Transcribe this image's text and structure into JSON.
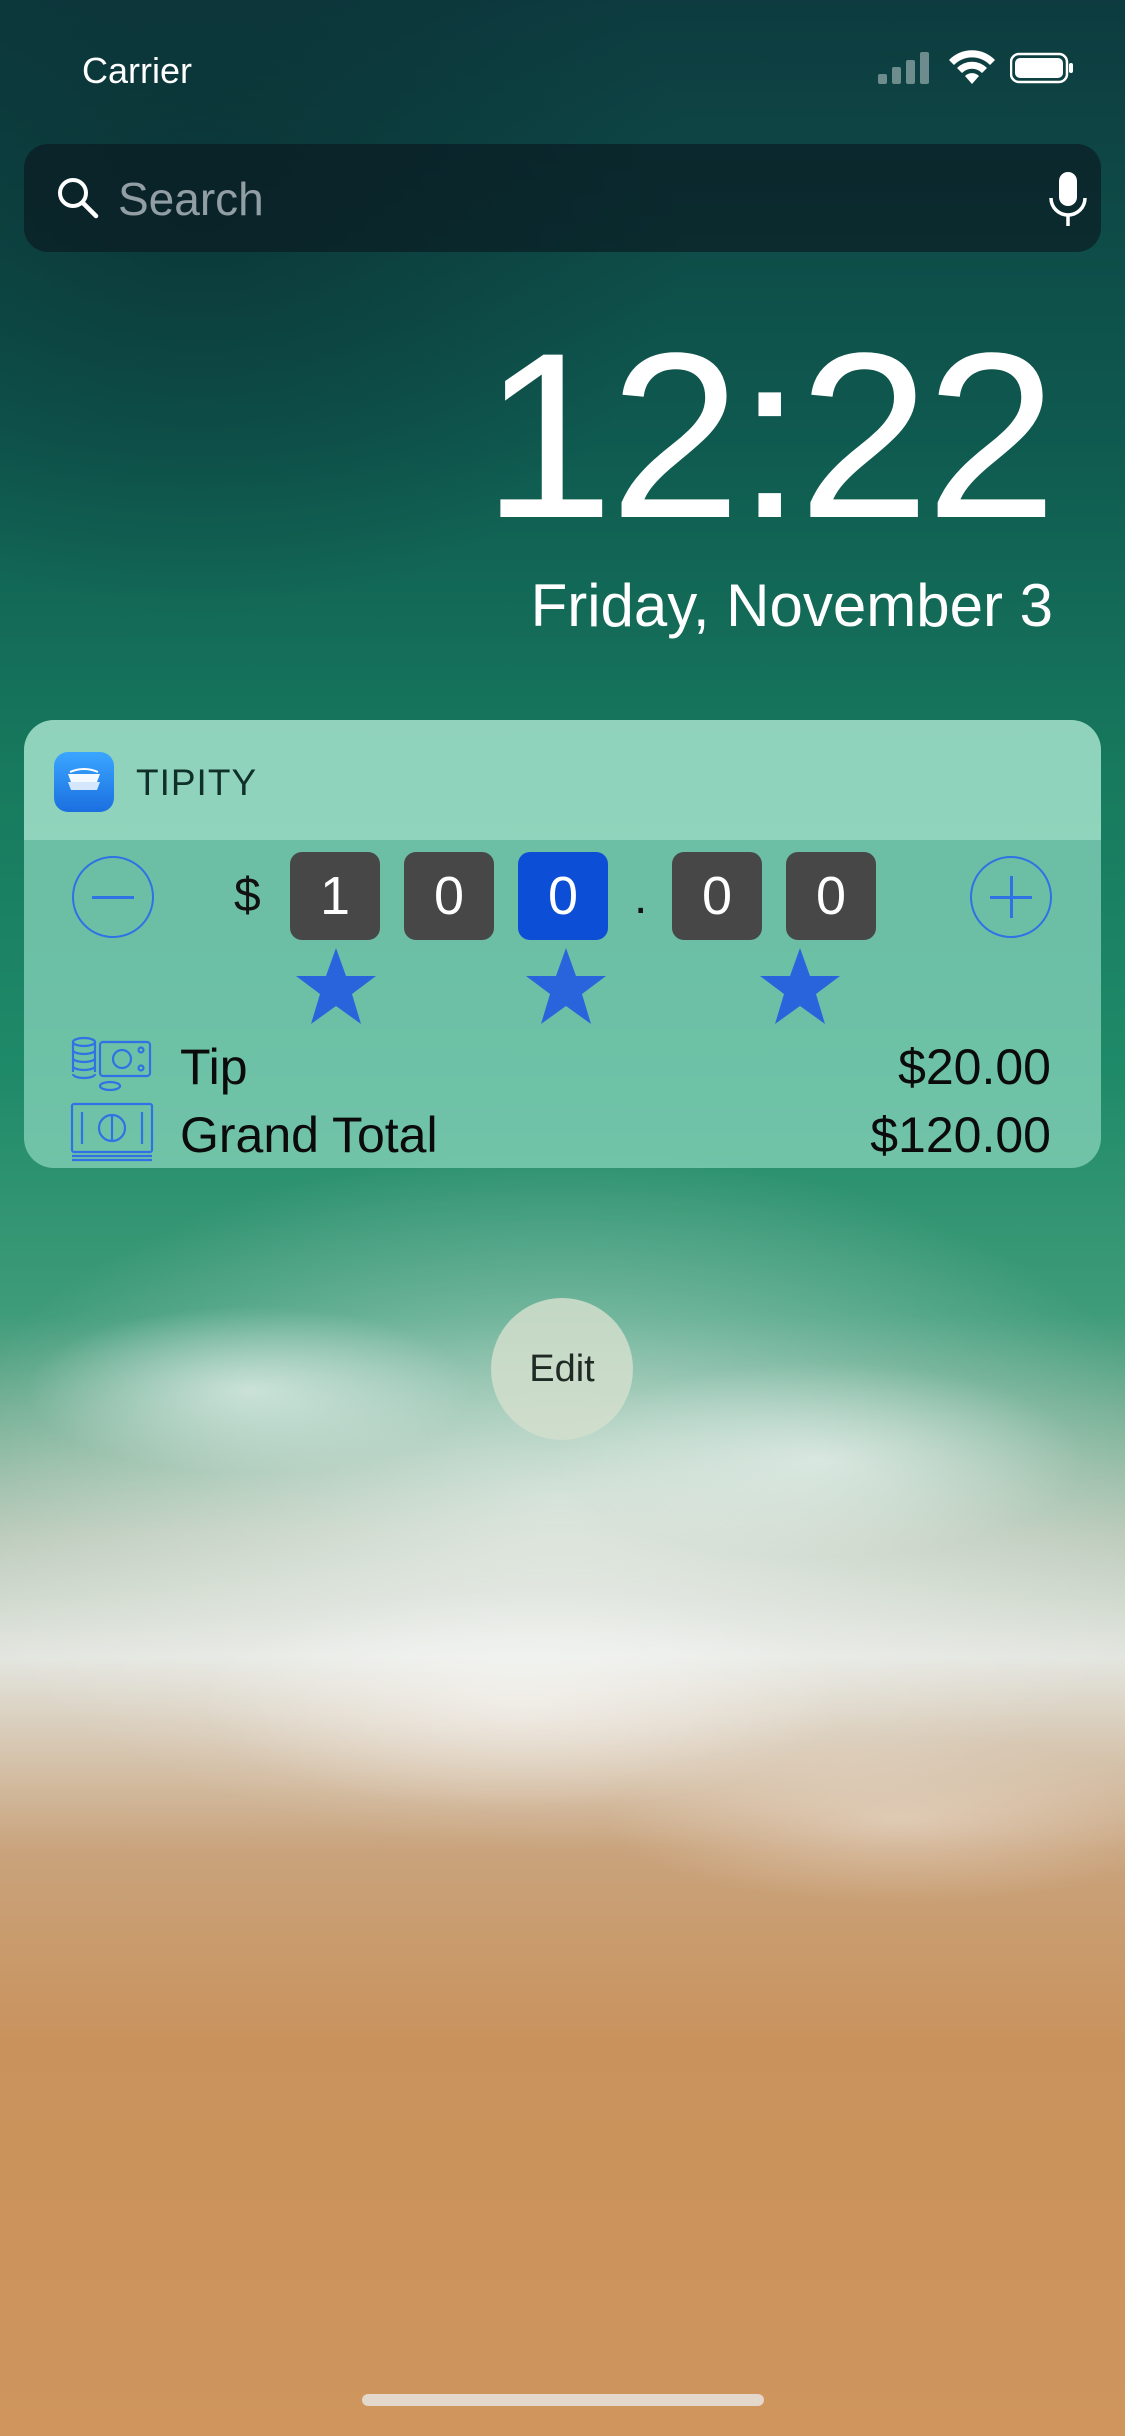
{
  "status_bar": {
    "carrier": "Carrier"
  },
  "search": {
    "placeholder": "Search"
  },
  "lock_screen": {
    "time": "12:22",
    "date": "Friday, November 3"
  },
  "widget": {
    "app_name": "TIPITY",
    "amount": {
      "currency_symbol": "$",
      "digits": [
        "1",
        "0",
        "0"
      ],
      "decimal_point": ".",
      "cents": [
        "0",
        "0"
      ],
      "active_digit_index": 2
    },
    "rating_stars": 3,
    "rows": [
      {
        "label": "Tip",
        "value": "$20.00",
        "icon": "coins-icon"
      },
      {
        "label": "Grand Total",
        "value": "$120.00",
        "icon": "banknotes-icon"
      }
    ],
    "colors": {
      "accent": "#2e72e6",
      "active_digit": "#0c4fd6",
      "digit_bg": "#474747"
    }
  },
  "edit_button": {
    "label": "Edit"
  }
}
